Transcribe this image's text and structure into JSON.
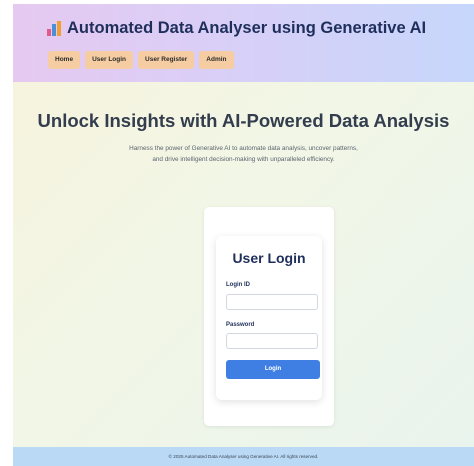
{
  "header": {
    "title": "Automated Data Analyser using Generative AI",
    "icon": "bar-chart-icon",
    "nav": [
      "Home",
      "User Login",
      "User Register",
      "Admin"
    ]
  },
  "hero": {
    "title": "Unlock Insights with AI-Powered Data Analysis",
    "subtitle_line1": "Harness the power of Generative AI to automate data analysis, uncover patterns,",
    "subtitle_line2": "and drive intelligent decision-making with unparalleled efficiency."
  },
  "login": {
    "title": "User Login",
    "login_id_label": "Login ID",
    "login_id_value": "",
    "password_label": "Password",
    "password_value": "",
    "button_label": "Login"
  },
  "footer": {
    "text": "© 2025 Automated Data Analyser using Generative AI. All rights reserved."
  },
  "colors": {
    "nav_button": "#f6cda2",
    "login_button": "#3f7fe3",
    "title_text": "#1f2f5c",
    "footer_bg": "#b9d9f4"
  }
}
